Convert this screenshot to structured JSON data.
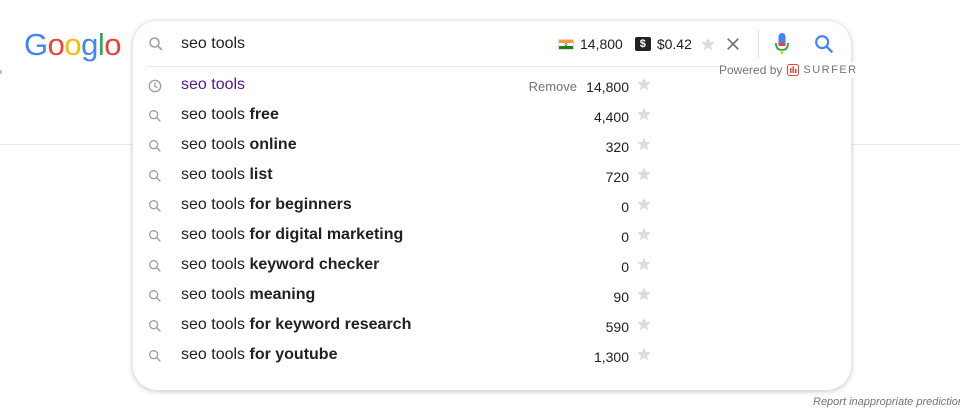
{
  "logo": {
    "letters": [
      {
        "ch": "G",
        "color": "#4285f4"
      },
      {
        "ch": "o",
        "color": "#ea4335"
      },
      {
        "ch": "o",
        "color": "#fbbc05"
      },
      {
        "ch": "g",
        "color": "#4285f4"
      },
      {
        "ch": "l",
        "color": "#34a853"
      },
      {
        "ch": "o",
        "color": "#ea4335"
      }
    ]
  },
  "search": {
    "query": "seo tools",
    "volume": "14,800",
    "cpc": "$0.42",
    "dollar_badge": "$",
    "flag_icon": "india-flag-icon"
  },
  "powered_by": {
    "label": "Powered by",
    "brand": "SURFER"
  },
  "suggestions": [
    {
      "prefix": "seo tools",
      "bold": "",
      "volume": "14,800",
      "history": true,
      "remove": "Remove"
    },
    {
      "prefix": "seo tools ",
      "bold": "free",
      "volume": "4,400"
    },
    {
      "prefix": "seo tools ",
      "bold": "online",
      "volume": "320"
    },
    {
      "prefix": "seo tools ",
      "bold": "list",
      "volume": "720"
    },
    {
      "prefix": "seo tools ",
      "bold": "for beginners",
      "volume": "0"
    },
    {
      "prefix": "seo tools ",
      "bold": "for digital marketing",
      "volume": "0"
    },
    {
      "prefix": "seo tools ",
      "bold": "keyword checker",
      "volume": "0"
    },
    {
      "prefix": "seo tools ",
      "bold": "meaning",
      "volume": "90"
    },
    {
      "prefix": "seo tools ",
      "bold": "for keyword research",
      "volume": "590"
    },
    {
      "prefix": "seo tools ",
      "bold": "for youtube",
      "volume": "1,300"
    }
  ],
  "footer": {
    "report": "Report inappropriate predictions"
  },
  "colors": {
    "history_text": "#52188c",
    "star": "#dadce0",
    "icon": "#9aa0a6",
    "mic_blue": "#4285f4",
    "mic_red": "#ea4335",
    "search_blue": "#4285f4"
  }
}
